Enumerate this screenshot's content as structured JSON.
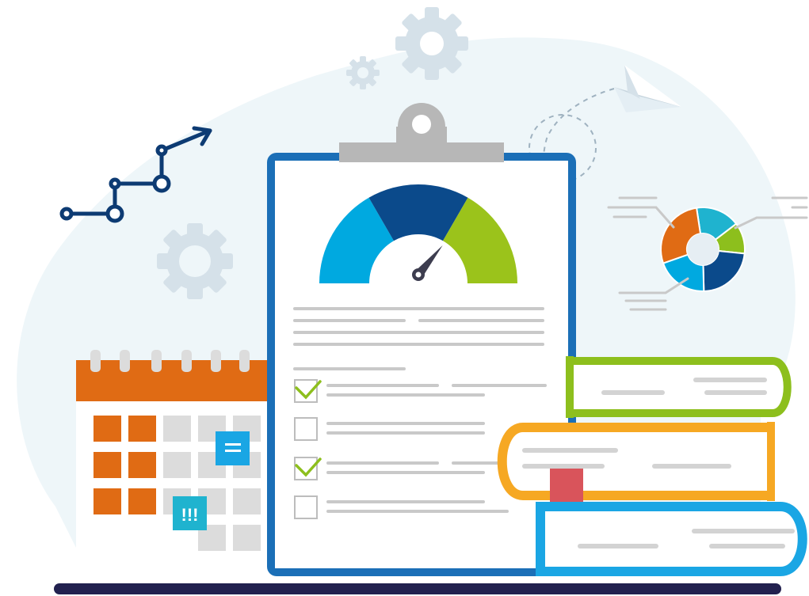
{
  "alert_badge": {
    "text": "!!!"
  },
  "gauge": {
    "needle_value": 0.72,
    "segments": [
      "#00a9e0",
      "#0b4a8b",
      "#9bc31b"
    ]
  },
  "checklist": {
    "items": [
      {
        "checked": true
      },
      {
        "checked": false
      },
      {
        "checked": true
      },
      {
        "checked": false
      }
    ]
  },
  "donut": {
    "slices": [
      {
        "value": 0.17,
        "color": "#1fb3cf"
      },
      {
        "value": 0.12,
        "color": "#8dbf1d"
      },
      {
        "value": 0.23,
        "color": "#0b4a8b"
      },
      {
        "value": 0.2,
        "color": "#00a9e0"
      },
      {
        "value": 0.28,
        "color": "#e06b14"
      }
    ]
  },
  "colors": {
    "blob": "#eef6f9",
    "gear": "#d5e1e9",
    "navy": "#0d3b73",
    "clipboard_frame": "#1b6fb7",
    "clip": "#b7b7b7",
    "calendar_orange": "#e06b14",
    "calendar_grey": "#dcdcdc",
    "line_grey": "#c9c9c9",
    "book_green": "#8dbf1d",
    "book_yellow": "#f6a823",
    "book_blue": "#1aa6e4",
    "ribbon": "#d9545b",
    "ground": "#22214f"
  },
  "icons": [
    "gear-icon",
    "growth-arrow-icon",
    "paper-plane-icon",
    "calendar-icon",
    "clipboard-icon",
    "gauge-icon",
    "donut-chart-icon",
    "books-icon",
    "checkmark-icon",
    "note-icon",
    "alert-icon"
  ]
}
